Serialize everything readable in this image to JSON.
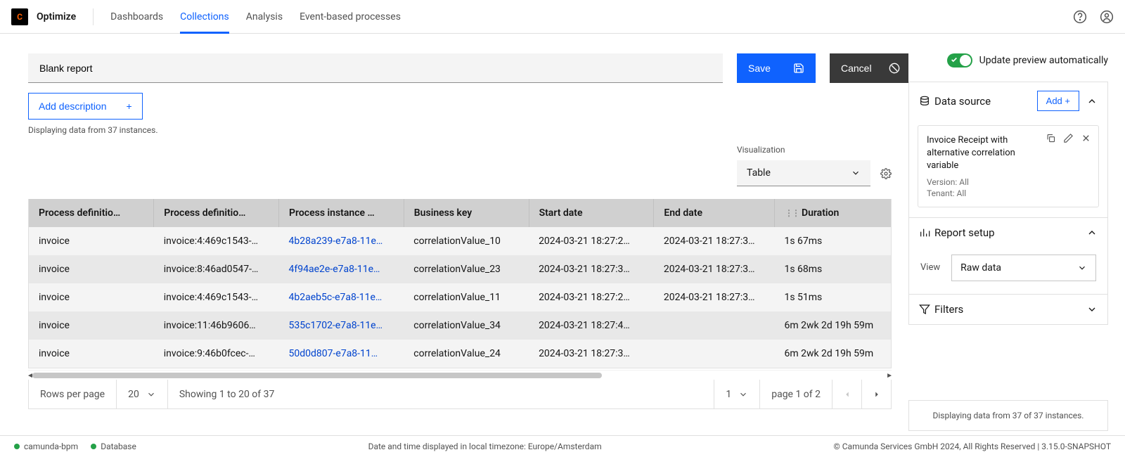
{
  "header": {
    "product": "Optimize",
    "nav": [
      "Dashboards",
      "Collections",
      "Analysis",
      "Event-based processes"
    ],
    "active_nav_index": 1
  },
  "title": {
    "value": "Blank report",
    "save": "Save",
    "cancel": "Cancel"
  },
  "desc": {
    "add": "Add description",
    "instances": "Displaying data from 37 instances."
  },
  "toggle": {
    "label": "Update preview automatically"
  },
  "viz": {
    "label": "Visualization",
    "value": "Table"
  },
  "table": {
    "columns": [
      "Process definitio…",
      "Process definitio…",
      "Process instance …",
      "Business key",
      "Start date",
      "End date",
      "Duration"
    ],
    "rows": [
      [
        "invoice",
        "invoice:4:469c1543-…",
        "4b28a239-e7a8-11e…",
        "correlationValue_10",
        "2024-03-21 18:27:2…",
        "2024-03-21 18:27:3…",
        "1s 67ms"
      ],
      [
        "invoice",
        "invoice:8:46ad0547-…",
        "4f94ae2e-e7a8-11e…",
        "correlationValue_23",
        "2024-03-21 18:27:3…",
        "2024-03-21 18:27:3…",
        "1s 68ms"
      ],
      [
        "invoice",
        "invoice:4:469c1543-…",
        "4b2aeb5c-e7a8-11e…",
        "correlationValue_11",
        "2024-03-21 18:27:2…",
        "2024-03-21 18:27:3…",
        "1s 51ms"
      ],
      [
        "invoice",
        "invoice:11:46b9606…",
        "535c1702-e7a8-11e…",
        "correlationValue_34",
        "2024-03-21 18:27:4…",
        "",
        "6m 2wk 2d 19h 59m"
      ],
      [
        "invoice",
        "invoice:9:46b0fcec-…",
        "50d0d807-e7a8-11…",
        "correlationValue_24",
        "2024-03-21 18:27:3…",
        "",
        "6m 2wk 2d 19h 59m"
      ]
    ]
  },
  "pager": {
    "rows_label": "Rows per page",
    "rows_value": "20",
    "showing": "Showing 1 to 20 of 37",
    "page_num": "1",
    "page_of": "page 1 of 2"
  },
  "right": {
    "data_source": {
      "title": "Data source",
      "add": "Add +"
    },
    "source": {
      "name": "Invoice Receipt with alternative correlation variable",
      "version": "Version: All",
      "tenant": "Tenant: All"
    },
    "report_setup": {
      "title": "Report setup",
      "view_label": "View",
      "view_value": "Raw data"
    },
    "filters": {
      "title": "Filters"
    },
    "footer": "Displaying data from 37 of 37 instances."
  },
  "statusbar": {
    "engines": [
      "camunda-bpm",
      "Database"
    ],
    "tz": "Date and time displayed in local timezone: Europe/Amsterdam",
    "copyright": "© Camunda Services GmbH 2024, All Rights Reserved | 3.15.0-SNAPSHOT"
  }
}
